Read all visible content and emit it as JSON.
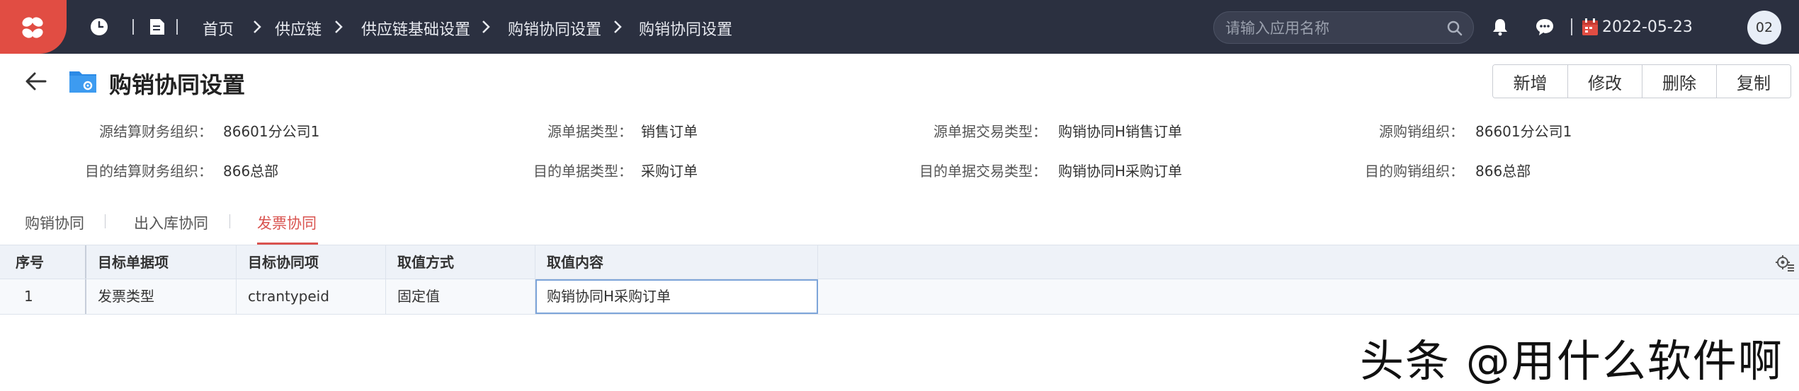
{
  "header": {
    "breadcrumbs": [
      "首页",
      "供应链",
      "供应链基础设置",
      "购销协同设置",
      "购销协同设置"
    ],
    "search_placeholder": "请输入应用名称",
    "date": "2022-05-23",
    "avatar_text": "02",
    "logo_color": "#e14d43",
    "bar_color": "#2b3040"
  },
  "page": {
    "title": "购销协同设置",
    "buttons": {
      "add": "新增",
      "edit": "修改",
      "delete": "删除",
      "copy": "复制"
    }
  },
  "form": {
    "row1": [
      {
        "label": "源结算财务组织：",
        "value": "86601分公司1"
      },
      {
        "label": "源单据类型：",
        "value": "销售订单"
      },
      {
        "label": "源单据交易类型：",
        "value": "购销协同H销售订单"
      },
      {
        "label": "源购销组织：",
        "value": "86601分公司1"
      }
    ],
    "row2": [
      {
        "label": "目的结算财务组织：",
        "value": "866总部"
      },
      {
        "label": "目的单据类型：",
        "value": "采购订单"
      },
      {
        "label": "目的单据交易类型：",
        "value": "购销协同H采购订单"
      },
      {
        "label": "目的购销组织：",
        "value": "866总部"
      }
    ]
  },
  "tabs": [
    {
      "label": "购销协同",
      "active": false
    },
    {
      "label": "出入库协同",
      "active": false
    },
    {
      "label": "发票协同",
      "active": true
    }
  ],
  "accent_color": "#d9534f",
  "table": {
    "columns": [
      "序号",
      "目标单据项",
      "目标协同项",
      "取值方式",
      "取值内容"
    ],
    "rows": [
      [
        "1",
        "发票类型",
        "ctrantypeid",
        "固定值",
        "购销协同H采购订单"
      ]
    ]
  },
  "watermark": "头条 @用什么软件啊"
}
